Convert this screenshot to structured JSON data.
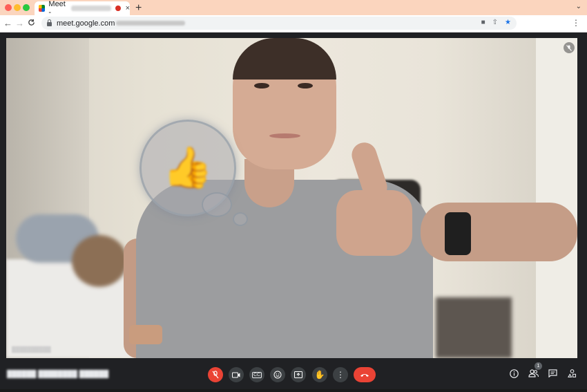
{
  "browser": {
    "tab_title": "Meet -",
    "new_tab": "+",
    "close_tab": "×",
    "tab_list": "⌄",
    "url": "meet.google.com",
    "nav_back": "←",
    "nav_forward": "→",
    "nav_reload": "C",
    "menu": "⋮"
  },
  "video": {
    "reaction_emoji": "👍",
    "tile_mute_icon": "mic-off-icon"
  },
  "controls": {
    "buttons": [
      {
        "name": "mic-off",
        "icon": "mic-off-icon",
        "color": "#ea4335"
      },
      {
        "name": "camera",
        "icon": "camera-icon"
      },
      {
        "name": "captions",
        "icon": "cc-icon",
        "label": "CC"
      },
      {
        "name": "emoji-reactions",
        "icon": "smile-icon"
      },
      {
        "name": "present",
        "icon": "present-icon"
      },
      {
        "name": "raise-hand",
        "icon": "hand-icon"
      },
      {
        "name": "more-options",
        "icon": "more-vert-icon"
      },
      {
        "name": "leave-call",
        "icon": "hang-up-icon",
        "color": "#ea4335"
      }
    ],
    "right": [
      {
        "name": "meeting-info",
        "icon": "info-icon"
      },
      {
        "name": "people",
        "icon": "people-icon",
        "badge": "1"
      },
      {
        "name": "chat",
        "icon": "chat-icon"
      },
      {
        "name": "activities",
        "icon": "activities-icon"
      }
    ],
    "participant_count": "1"
  }
}
